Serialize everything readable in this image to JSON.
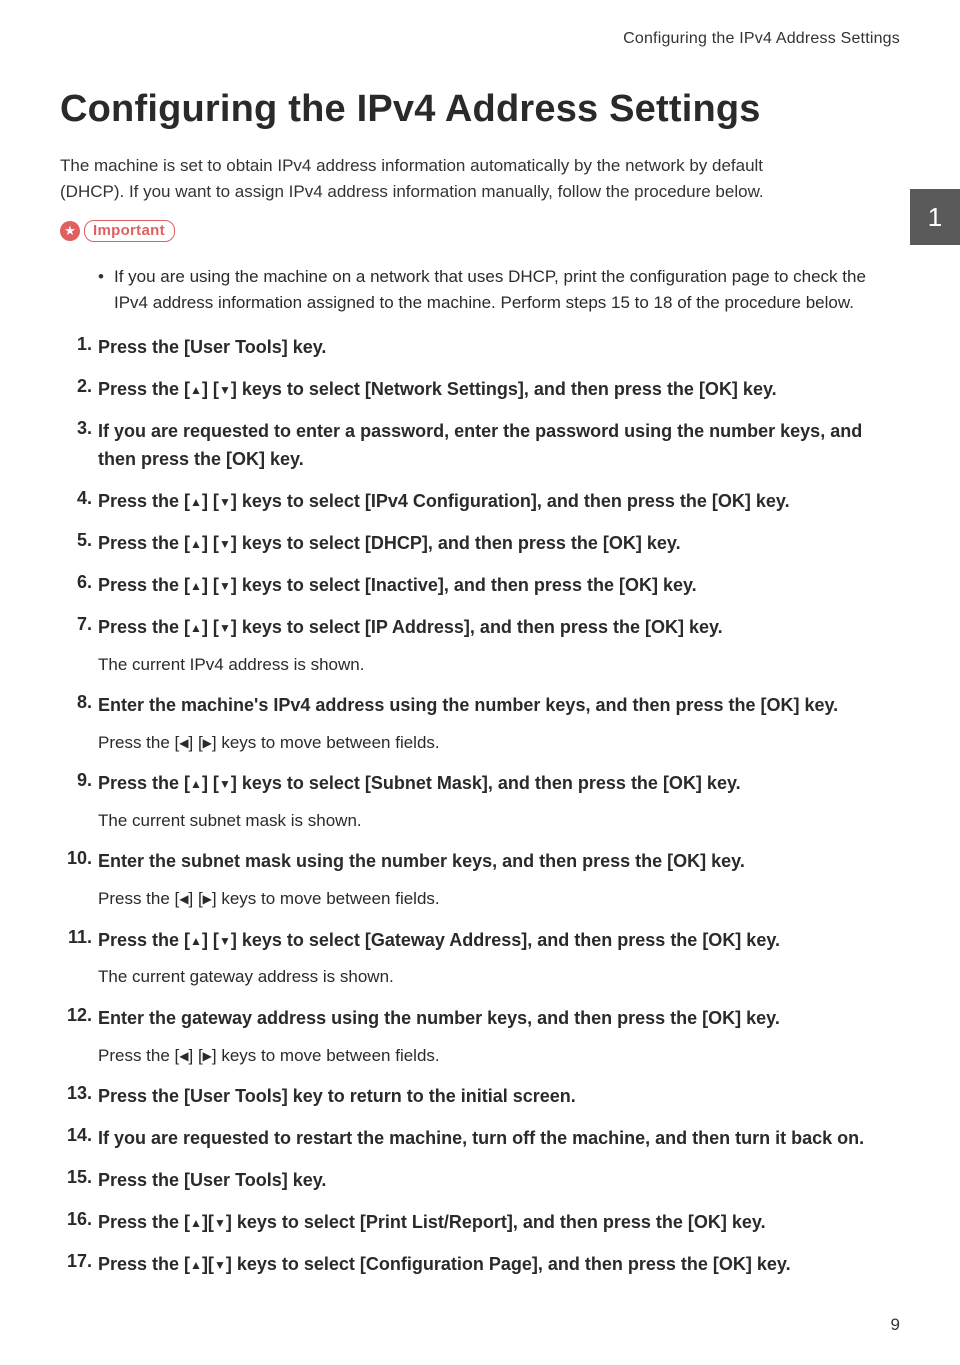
{
  "header_right": "Configuring the IPv4 Address Settings",
  "title": "Configuring the IPv4 Address Settings",
  "intro": "The machine is set to obtain IPv4 address information automatically by the network by default (DHCP). If you want to assign IPv4 address information manually, follow the procedure below.",
  "side_tab": "1",
  "important_label": "Important",
  "important_bullet": "If you are using the machine on a network that uses DHCP, print the configuration page to check the IPv4 address information assigned to the machine. Perform steps 15 to 18 of the procedure below.",
  "steps": [
    {
      "bold": "Press the [User Tools] key."
    },
    {
      "bold_parts": [
        "Press the [",
        "UP",
        "] [",
        "DOWN",
        "] keys to select [Network Settings], and then press the [OK] key."
      ]
    },
    {
      "bold": "If you are requested to enter a password, enter the password using the number keys, and then press the [OK] key."
    },
    {
      "bold_parts": [
        "Press the [",
        "UP",
        "] [",
        "DOWN",
        "] keys to select [IPv4 Configuration], and then press the [OK] key."
      ]
    },
    {
      "bold_parts": [
        "Press the [",
        "UP",
        "] [",
        "DOWN",
        "] keys to select [DHCP], and then press the [OK] key."
      ]
    },
    {
      "bold_parts": [
        "Press the [",
        "UP",
        "] [",
        "DOWN",
        "] keys to select [Inactive], and then press the [OK] key."
      ]
    },
    {
      "bold_parts": [
        "Press the [",
        "UP",
        "] [",
        "DOWN",
        "] keys to select [IP Address], and then press the [OK] key."
      ],
      "note": "The current IPv4 address is shown."
    },
    {
      "bold": "Enter the machine's IPv4 address using the number keys, and then press the [OK] key.",
      "note_parts": [
        "Press the [",
        "LEFT",
        "] [",
        "RIGHT",
        "] keys to move between fields."
      ]
    },
    {
      "bold_parts": [
        "Press the [",
        "UP",
        "] [",
        "DOWN",
        "] keys to select [Subnet Mask], and then press the [OK] key."
      ],
      "note": "The current subnet mask is shown."
    },
    {
      "bold": "Enter the subnet mask using the number keys, and then press the [OK] key.",
      "note_parts": [
        "Press the [",
        "LEFT",
        "] [",
        "RIGHT",
        "] keys to move between fields."
      ]
    },
    {
      "bold_parts": [
        "Press the [",
        "UP",
        "] [",
        "DOWN",
        "] keys to select [Gateway Address], and then press the [OK] key."
      ],
      "note": "The current gateway address is shown."
    },
    {
      "bold": "Enter the gateway address using the number keys, and then press the [OK] key.",
      "note_parts": [
        "Press the [",
        "LEFT",
        "] [",
        "RIGHT",
        "] keys to move between fields."
      ]
    },
    {
      "bold": "Press the [User Tools] key to return to the initial screen."
    },
    {
      "bold": "If you are requested to restart the machine, turn off the machine, and then turn it back on."
    },
    {
      "bold": "Press the [User Tools] key."
    },
    {
      "bold_parts": [
        "Press the [",
        "UP",
        "][",
        "DOWN",
        "] keys to select [Print List/Report], and then press the [OK] key."
      ]
    },
    {
      "bold_parts": [
        "Press the [",
        "UP",
        "][",
        "DOWN",
        "] keys to select [Configuration Page], and then press the [OK] key."
      ]
    }
  ],
  "page_number": "9",
  "icons": {
    "UP": "▲",
    "DOWN": "▼",
    "LEFT": "◀",
    "RIGHT": "▶"
  }
}
